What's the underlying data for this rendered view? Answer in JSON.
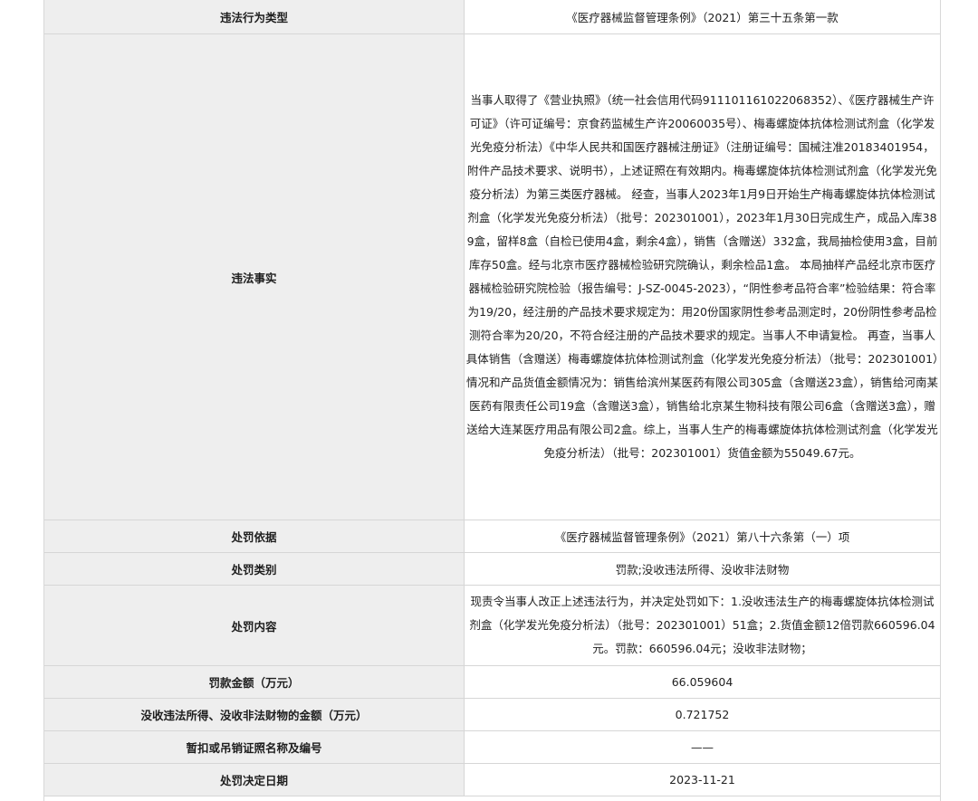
{
  "rows": [
    {
      "label": "违法行为类型",
      "value": "《医疗器械监督管理条例》（2021）第三十五条第一款"
    },
    {
      "label": "违法事实",
      "value": "当事人取得了《营业执照》（统一社会信用代码91110116102206835​2）、《医疗器械生产许可证》（许可证编号：京食药监械生产许20060035号）、梅毒螺旋体抗体检测试剂盒（化学发光免疫分析法）《中华人民共和国医疗器械注册证》（注册证编号：国械注准20183401954，附件产品技术要求、说明书），上述证照在有效期内。梅毒螺旋体抗体检测试剂盒（化学发光免疫分析法）为第三类医疗器械。 经查，当事人2023年1月9日开始生产梅毒螺旋体抗体检测试剂盒（化学发光免疫分析法）（批号：202301001），2023年1月30日完成生产，成品入库389盒，留样8盒（自检已使用4盒，剩余4盒），销售（含赠送）332盒，我局抽检使用3盒，目前库存50盒。经与北京市医疗器械检验研究院确认，剩余检品1盒。 本局抽样产品经北京市医疗器械检验研究院检验（报告编号：J-SZ-0045-2023），“阴性参考品符合率”检验结果：符合率为19/20，经注册的产品技术要求规定为：用20份国家阴性参考品测定时，20份阴性参考品检测符合率为20/20，不符合经注册的产品技术要求的规定。当事人不申请复检。 再查，当事人具体销售（含赠送）梅毒螺旋体抗体检测试剂盒（化学发光免疫分析法）（批号：202301001）情况和产品货值金额情况为：销售给滨州某医药有限公司305盒（含赠送23盒），销售给河南某医药有限责任公司19盒（含赠送3盒），销售给北京某生物科技有限公司6盒（含赠送3盒），赠送给大连某医疗用品有限公司2盒。综上，当事人生产的梅毒螺旋体抗体检测试剂盒（化学发光免疫分析法）（批号：202301001）货值金额为55049.67元。"
    },
    {
      "label": "处罚依据",
      "value": "《医疗器械监督管理条例》（2021）第八十六条第（一）项"
    },
    {
      "label": "处罚类别",
      "value": "罚款;没收违法所得、没收非法财物"
    },
    {
      "label": "处罚内容",
      "value": "现责令当事人改正上述违法行为，并决定处罚如下：1.没收违法生产的梅毒螺旋体抗体检测试剂盒（化学发光免疫分析法）（批号：202301001）51盒；2.货值金额12倍罚款660596.04元。罚款：660596.04元；没收非法财物；"
    },
    {
      "label": "罚款金额（万元）",
      "value": "66.059604"
    },
    {
      "label": "没收违法所得、没收非法财物的金额（万元）",
      "value": "0.721752"
    },
    {
      "label": "暂扣或吊销证照名称及编号",
      "value": "——"
    },
    {
      "label": "处罚决定日期",
      "value": "2023-11-21"
    }
  ]
}
